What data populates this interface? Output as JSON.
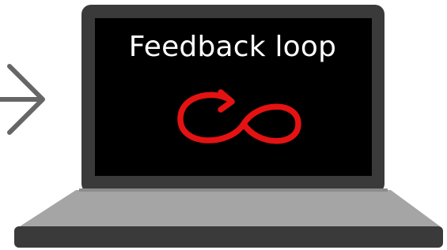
{
  "screen": {
    "title": "Feedback loop"
  },
  "icons": {
    "arrow": "right-arrow-icon",
    "loop": "infinity-loop-icon"
  },
  "colors": {
    "laptop_body": "#3a3a3a",
    "screen_bg": "#000000",
    "keyboard_deck": "#a5a5a5",
    "arrow_stroke": "#666666",
    "loop_accent": "#e41212",
    "title_text": "#ffffff"
  }
}
